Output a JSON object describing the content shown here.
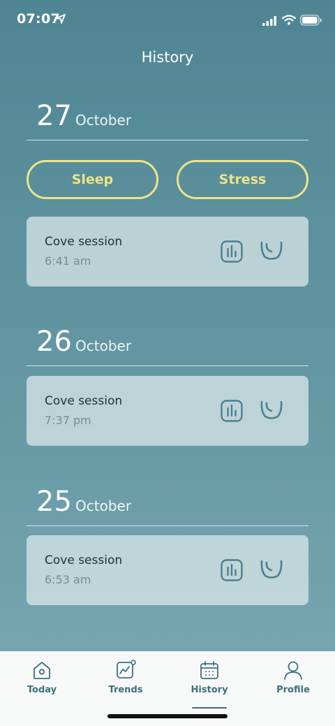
{
  "status": {
    "time": "07:07"
  },
  "header": {
    "title": "History"
  },
  "filters": {
    "sleep_label": "Sleep",
    "stress_label": "Stress"
  },
  "days": [
    {
      "day": "27",
      "month": "October",
      "sessions": [
        {
          "title": "Cove session",
          "time": "6:41 am"
        }
      ]
    },
    {
      "day": "26",
      "month": "October",
      "sessions": [
        {
          "title": "Cove session",
          "time": "7:37 pm"
        }
      ]
    },
    {
      "day": "25",
      "month": "October",
      "sessions": [
        {
          "title": "Cove session",
          "time": "6:53 am"
        }
      ]
    }
  ],
  "tabs": [
    {
      "label": "Today",
      "icon": "home-icon"
    },
    {
      "label": "Trends",
      "icon": "trends-icon"
    },
    {
      "label": "History",
      "icon": "calendar-icon",
      "active": true
    },
    {
      "label": "Profile",
      "icon": "profile-icon"
    }
  ],
  "colors": {
    "accent": "#ece488",
    "tab_text": "#3d6f7c",
    "card": "#d2e2e5"
  }
}
